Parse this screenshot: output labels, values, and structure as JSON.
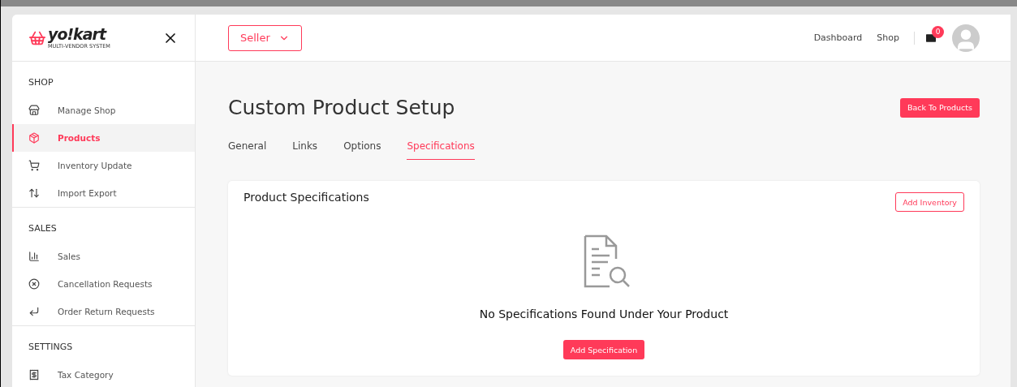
{
  "logo": {
    "name": "yo!kart",
    "tagline": "MULTI-VENDOR SYSTEM"
  },
  "header": {
    "role_dropdown": "Seller",
    "links": [
      "Dashboard",
      "Shop"
    ],
    "notifications": "0"
  },
  "sidebar": {
    "sections": [
      {
        "title": "SHOP",
        "items": [
          {
            "label": "Manage Shop",
            "kind": "store",
            "selected": false
          },
          {
            "label": "Products",
            "kind": "box",
            "selected": true
          },
          {
            "label": "Inventory Update",
            "kind": "cart",
            "selected": false
          },
          {
            "label": "Import Export",
            "kind": "arrows",
            "selected": false
          }
        ]
      },
      {
        "title": "SALES",
        "items": [
          {
            "label": "Sales",
            "kind": "chart",
            "selected": false
          },
          {
            "label": "Cancellation Requests",
            "kind": "cancel",
            "selected": false
          },
          {
            "label": "Order Return Requests",
            "kind": "return",
            "selected": false
          }
        ]
      },
      {
        "title": "SETTINGS",
        "items": [
          {
            "label": "Tax Category",
            "kind": "receipt",
            "selected": false
          }
        ]
      }
    ]
  },
  "page": {
    "title": "Custom Product Setup",
    "back_button": "Back To Products",
    "tabs": [
      {
        "label": "General",
        "selected": false
      },
      {
        "label": "Links",
        "selected": false
      },
      {
        "label": "Options",
        "selected": false
      },
      {
        "label": "Specifications",
        "selected": true
      }
    ],
    "card": {
      "title": "Product Specifications",
      "action": "Add Inventory",
      "empty_message": "No Specifications Found Under Your Product",
      "empty_action": "Add Specification"
    }
  }
}
